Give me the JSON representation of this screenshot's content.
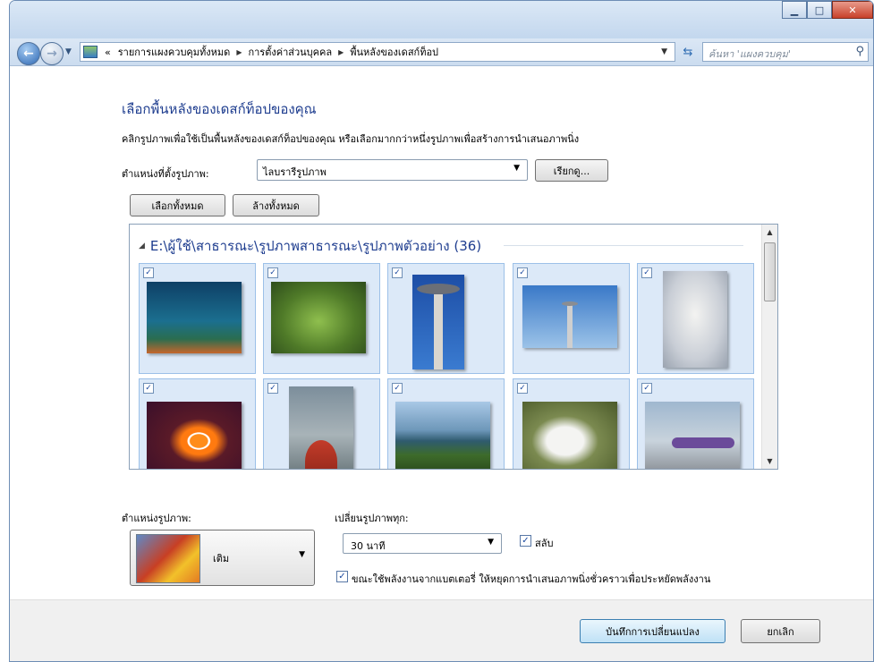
{
  "address": {
    "overflow": "«",
    "breadcrumbs": [
      "รายการแผงควบคุมทั้งหมด",
      "การตั้งค่าส่วนบุคคล",
      "พื้นหลังของเดสก์ท็อป"
    ],
    "search_placeholder": "ค้นหา 'แผงควบคุม'"
  },
  "main": {
    "heading": "เลือกพื้นหลังของเดสก์ท็อปของคุณ",
    "description": "คลิกรูปภาพเพื่อใช้เป็นพื้นหลังของเดสก์ท็อปของคุณ หรือเลือกมากกว่าหนึ่งรูปภาพเพื่อสร้างการนำเสนอภาพนิ่ง",
    "location_label": "ตำแหน่งที่ตั้งรูปภาพ:",
    "location_value": "ไลบรารีรูปภาพ",
    "browse_button": "เรียกดู...",
    "select_all_button": "เลือกทั้งหมด",
    "clear_all_button": "ล้างทั้งหมด"
  },
  "gallery": {
    "group_title": "E:\\ผู้ใช้\\สาธารณะ\\รูปภาพสาธารณะ\\รูปภาพตัวอย่าง (36)",
    "images": [
      {
        "name": "coral-reef",
        "checked": true
      },
      {
        "name": "green-leaf",
        "checked": true
      },
      {
        "name": "space-needle-closeup",
        "checked": true
      },
      {
        "name": "space-needle-sky",
        "checked": true
      },
      {
        "name": "husky-snow",
        "checked": true
      },
      {
        "name": "clownfish",
        "checked": true
      },
      {
        "name": "kayak",
        "checked": true
      },
      {
        "name": "palm-coast",
        "checked": true
      },
      {
        "name": "dog-stretching",
        "checked": true
      },
      {
        "name": "airplane-tails",
        "checked": true
      }
    ]
  },
  "bottom": {
    "position_label": "ตำแหน่งรูปภาพ:",
    "position_value": "เติม",
    "interval_label": "เปลี่ยนรูปภาพทุก:",
    "interval_value": "30 นาที",
    "shuffle_label": "สลับ",
    "shuffle_checked": true,
    "battery_label": "ขณะใช้พลังงานจากแบตเตอรี่ ให้หยุดการนำเสนอภาพนิ่งชั่วคราวเพื่อประหยัดพลังงาน",
    "battery_checked": true
  },
  "footer": {
    "save_button": "บันทึกการเปลี่ยนแปลง",
    "cancel_button": "ยกเลิก"
  }
}
